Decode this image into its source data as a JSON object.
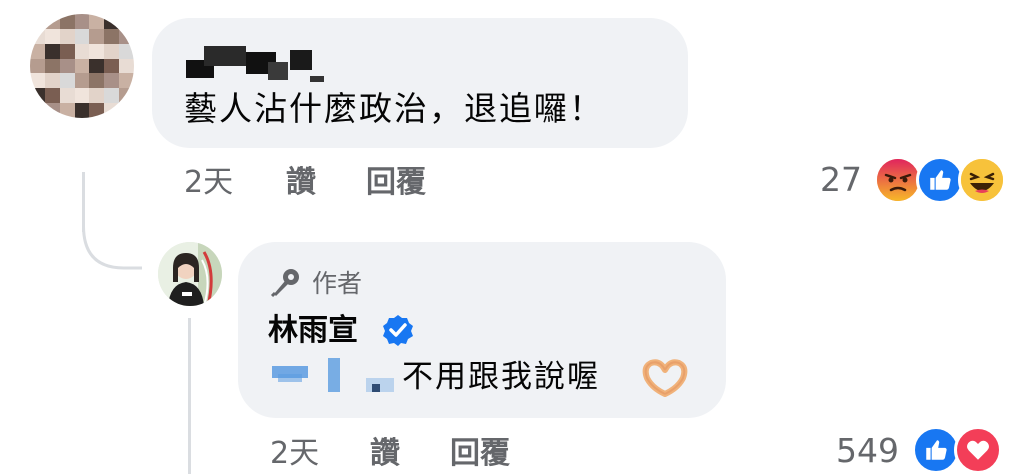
{
  "comment1": {
    "text": "藝人沾什麼政治，退追囉！",
    "time": "2天",
    "like_label": "讚",
    "reply_label": "回覆",
    "reaction_count": "27",
    "reactions": [
      "angry-icon",
      "like-icon",
      "haha-icon"
    ]
  },
  "reply": {
    "author_badge": "作者",
    "author_name": "林雨宣",
    "text": "不用跟我說喔",
    "emoji": "heart-hands-icon",
    "time": "2天",
    "like_label": "讚",
    "reply_label": "回覆",
    "reaction_count": "549",
    "reactions": [
      "like-icon",
      "love-icon"
    ]
  },
  "colors": {
    "bubble": "#f0f2f5",
    "secondary_text": "#65676b",
    "like_blue": "#1877f2",
    "love_red": "#f33e58",
    "angry_orange": "#e9710f",
    "haha_yellow": "#f7b928",
    "verified_blue": "#1877f2"
  }
}
